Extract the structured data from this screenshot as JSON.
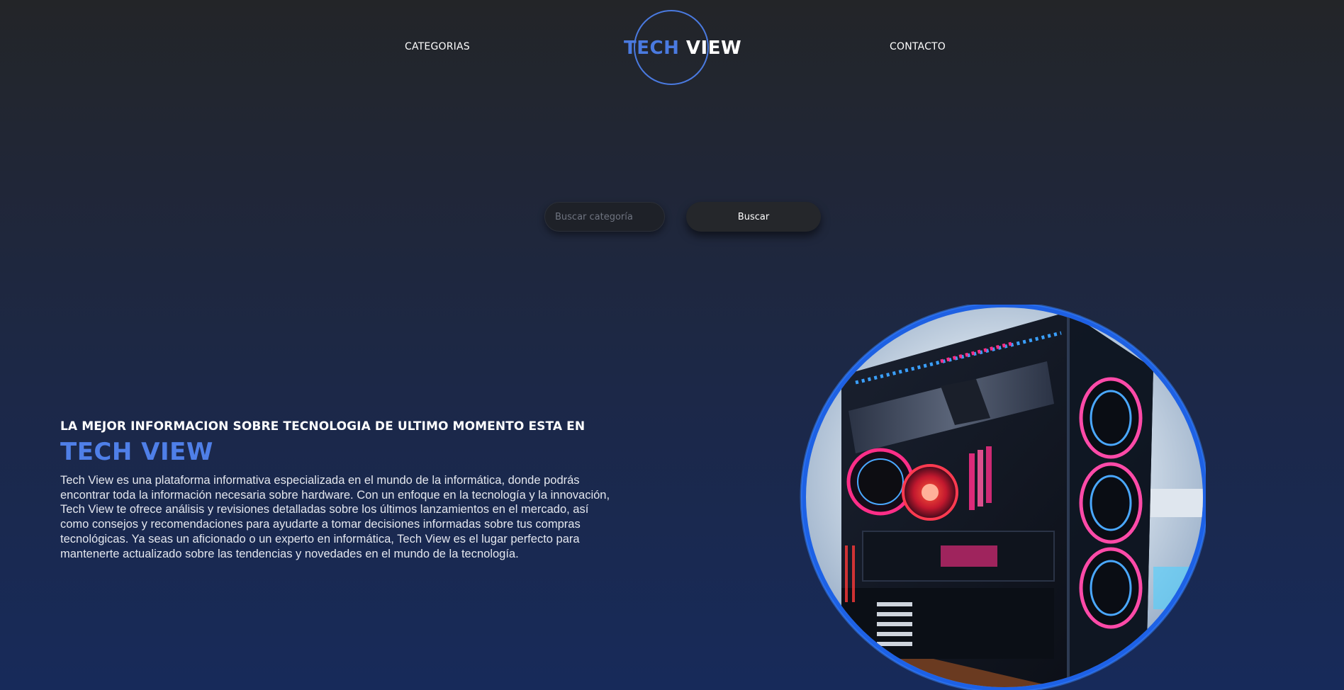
{
  "nav": {
    "categorias_label": "CATEGORIAS",
    "contacto_label": "CONTACTO",
    "logo": {
      "part1": "TECH",
      "part2": "VIEW"
    }
  },
  "search": {
    "placeholder": "Buscar categoría",
    "button_label": "Buscar"
  },
  "hero": {
    "heading": "LA MEJOR INFORMACION SOBRE TECNOLOGIA DE ULTIMO MOMENTO ESTA EN",
    "brand": "TECH VIEW",
    "description": "Tech View es una plataforma informativa especializada en el mundo de la informática, donde podrás encontrar toda la información necesaria sobre hardware. Con un enfoque en la tecnología y la innovación, Tech View te ofrece análisis y revisiones detalladas sobre los últimos lanzamientos en el mercado, así como consejos y recomendaciones para ayudarte a tomar decisiones informadas sobre tus compras tecnológicas. Ya seas un aficionado o un experto en informática, Tech View es el lugar perfecto para mantenerte actualizado sobre las tendencias y novedades en el mundo de la tecnología."
  },
  "colors": {
    "accent": "#4a7ae0",
    "background_top": "#232528",
    "background_bottom": "#172a5a",
    "glow": "#1e6bff",
    "rgb_pink": "#ff2e88",
    "rgb_blue": "#3aa0ff"
  },
  "icons": {
    "hero_image": "gaming-pc-image"
  }
}
